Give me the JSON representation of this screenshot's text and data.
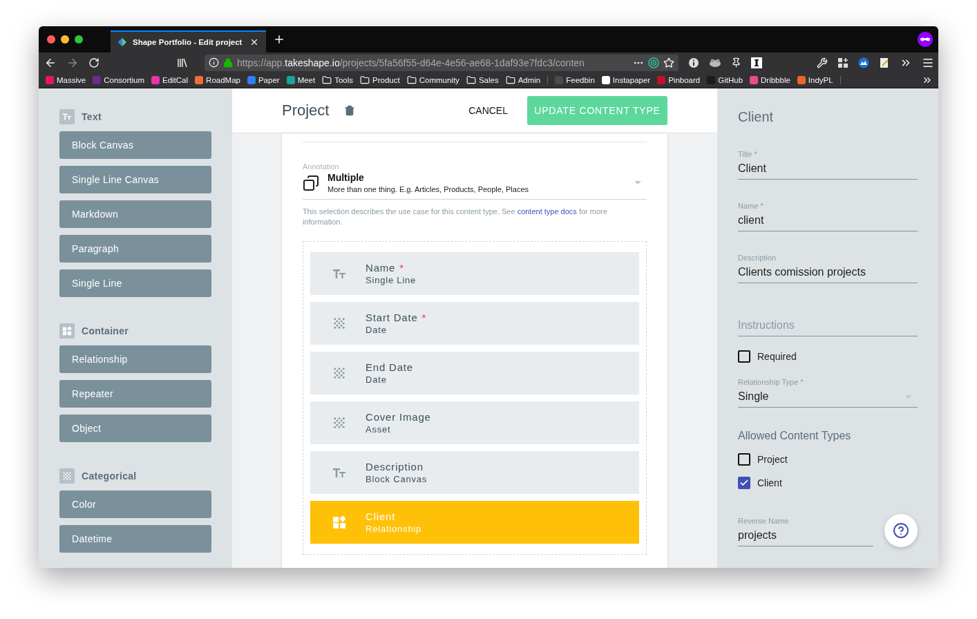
{
  "browser": {
    "tab": {
      "title": "Shape Portfolio - Edit project",
      "selected": true
    },
    "url": {
      "scheme": "https://app.",
      "domain": "takeshape.io",
      "path": "/projects/5fa56f55-d64e-4e56-ae68-1daf93e7fdc3/conten"
    },
    "bookmarks": [
      {
        "label": "Massive",
        "kind": "site",
        "color": "#e8175d"
      },
      {
        "label": "Consortium",
        "kind": "site",
        "color": "#6b2d8a"
      },
      {
        "label": "EditCal",
        "kind": "site",
        "color": "#e535ab"
      },
      {
        "label": "RoadMap",
        "kind": "site",
        "color": "#f26b3a"
      },
      {
        "label": "Paper",
        "kind": "site",
        "color": "#2f7ff0"
      },
      {
        "label": "Meet",
        "kind": "site",
        "color": "#1aa39a"
      },
      {
        "label": "Tools",
        "kind": "folder"
      },
      {
        "label": "Product",
        "kind": "folder"
      },
      {
        "label": "Community",
        "kind": "folder"
      },
      {
        "label": "Sales",
        "kind": "folder"
      },
      {
        "label": "Admin",
        "kind": "folder"
      },
      {
        "label": "Feedbin",
        "kind": "site",
        "color": "#4a4a4a"
      },
      {
        "label": "Instapaper",
        "kind": "site",
        "color": "#ffffff"
      },
      {
        "label": "Pinboard",
        "kind": "site",
        "color": "#c0112a"
      },
      {
        "label": "GitHub",
        "kind": "site",
        "color": "#1b1b1b"
      },
      {
        "label": "Dribbble",
        "kind": "site",
        "color": "#ea4c89"
      },
      {
        "label": "IndyPL",
        "kind": "site",
        "color": "#f0622c"
      }
    ]
  },
  "sidebar": {
    "sections": [
      {
        "title": "Text",
        "kind": "text",
        "items": [
          "Block Canvas",
          "Single Line Canvas",
          "Markdown",
          "Paragraph",
          "Single Line"
        ]
      },
      {
        "title": "Container",
        "kind": "widgets",
        "items": [
          "Relationship",
          "Repeater",
          "Object"
        ]
      },
      {
        "title": "Categorical",
        "kind": "dots",
        "items": [
          "Color",
          "Datetime"
        ]
      }
    ]
  },
  "header": {
    "title": "Project",
    "cancel": "CANCEL",
    "submit": "UPDATE CONTENT TYPE"
  },
  "annotation": {
    "label": "Annotation",
    "value": "Multiple",
    "description": "More than one thing. E.g. Articles, Products, People, Places",
    "help_before": "This selection describes the use case for this content type. See ",
    "help_link": "content type docs",
    "help_after": " for more information."
  },
  "fields": [
    {
      "name": "Name",
      "mark": "*",
      "type": "Single Line",
      "kind": "text",
      "selected": false
    },
    {
      "name": "Start Date",
      "mark": "*",
      "type": "Date",
      "kind": "dots",
      "selected": false
    },
    {
      "name": "End Date",
      "type": "Date",
      "kind": "dots",
      "selected": false
    },
    {
      "name": "Cover Image",
      "type": "Asset",
      "kind": "dots",
      "selected": false
    },
    {
      "name": "Description",
      "type": "Block Canvas",
      "kind": "text",
      "selected": false
    },
    {
      "name": "Client",
      "type": "Relationship",
      "kind": "widgets",
      "selected": true
    }
  ],
  "panel": {
    "title": "Client",
    "inputs": [
      {
        "label": "Title *",
        "value": "Client"
      },
      {
        "label": "Name *",
        "value": "client"
      },
      {
        "label": "Description",
        "value": "Clients comission projects"
      }
    ],
    "instructions": {
      "placeholder": "Instructions"
    },
    "required": {
      "label": "Required",
      "checked": false
    },
    "relationship_type": {
      "label": "Relationship Type *",
      "value": "Single"
    },
    "allowed": {
      "title": "Allowed Content Types",
      "options": [
        {
          "label": "Project",
          "checked": false
        },
        {
          "label": "Client",
          "checked": true
        }
      ]
    },
    "reverse_name": {
      "label": "Reverse Name",
      "value": "projects"
    }
  }
}
